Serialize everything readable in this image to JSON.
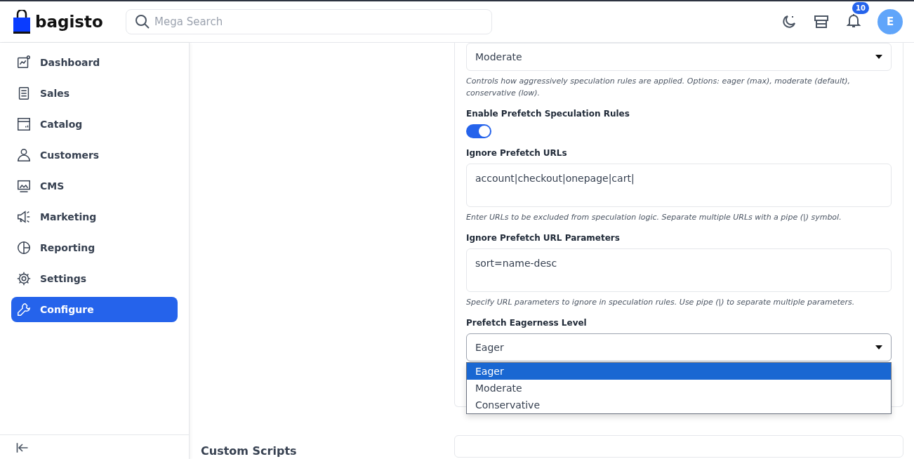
{
  "header": {
    "logo": "bagisto",
    "search": {
      "placeholder": "Mega Search"
    },
    "notifications": "10",
    "avatar": "E"
  },
  "sidebar": {
    "items": [
      {
        "label": "Dashboard",
        "selected": false
      },
      {
        "label": "Sales",
        "selected": false
      },
      {
        "label": "Catalog",
        "selected": false
      },
      {
        "label": "Customers",
        "selected": false
      },
      {
        "label": "CMS",
        "selected": false
      },
      {
        "label": "Marketing",
        "selected": false
      },
      {
        "label": "Reporting",
        "selected": false
      },
      {
        "label": "Settings",
        "selected": false
      },
      {
        "label": "Configure",
        "selected": true
      }
    ]
  },
  "form": {
    "fields": [
      {
        "kind": "select",
        "value": "Moderate",
        "hint": "Controls how aggressively speculation rules are applied. Options: eager (max), moderate (default), conservative (low)."
      },
      {
        "kind": "toggle",
        "label": "Enable Prefetch Speculation Rules",
        "on": true
      },
      {
        "kind": "textarea",
        "label": "Ignore Prefetch URLs",
        "value": "account|checkout|onepage|cart|",
        "hint": "Enter URLs to be excluded from speculation logic. Separate multiple URLs with a pipe (|) symbol."
      },
      {
        "kind": "textarea",
        "label": "Ignore Prefetch URL Parameters",
        "value": "sort=name-desc",
        "hint": "Specify URL parameters to ignore in speculation rules. Use pipe (|) to separate multiple parameters."
      },
      {
        "kind": "select",
        "label": "Prefetch Eagerness Level",
        "value": "Eager",
        "expanded": true,
        "options": [
          {
            "label": "Eager",
            "selected": true
          },
          {
            "label": "Moderate",
            "selected": false
          },
          {
            "label": "Conservative",
            "selected": false
          }
        ]
      }
    ]
  },
  "section_title": "Custom Scripts"
}
